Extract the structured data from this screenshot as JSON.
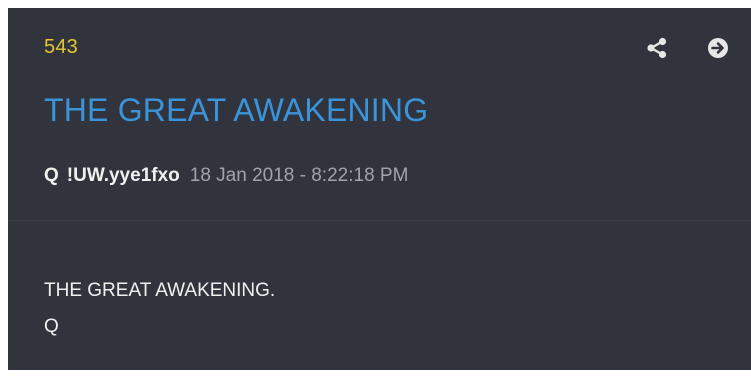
{
  "post": {
    "number": "543",
    "title": "THE GREAT AWAKENING",
    "author": "Q",
    "tripcode": "!UW.yye1fxo",
    "timestamp": "18 Jan 2018 - 8:22:18 PM",
    "body_lines": [
      "THE GREAT AWAKENING.",
      "Q"
    ]
  },
  "icons": {
    "share": "share-icon",
    "goto": "arrow-right-circle-icon"
  },
  "colors": {
    "card_background": "#31343d",
    "post_number": "#e4c631",
    "title_link": "#3b94d9",
    "text": "#f0f0f0",
    "timestamp": "#a0a3aa"
  }
}
